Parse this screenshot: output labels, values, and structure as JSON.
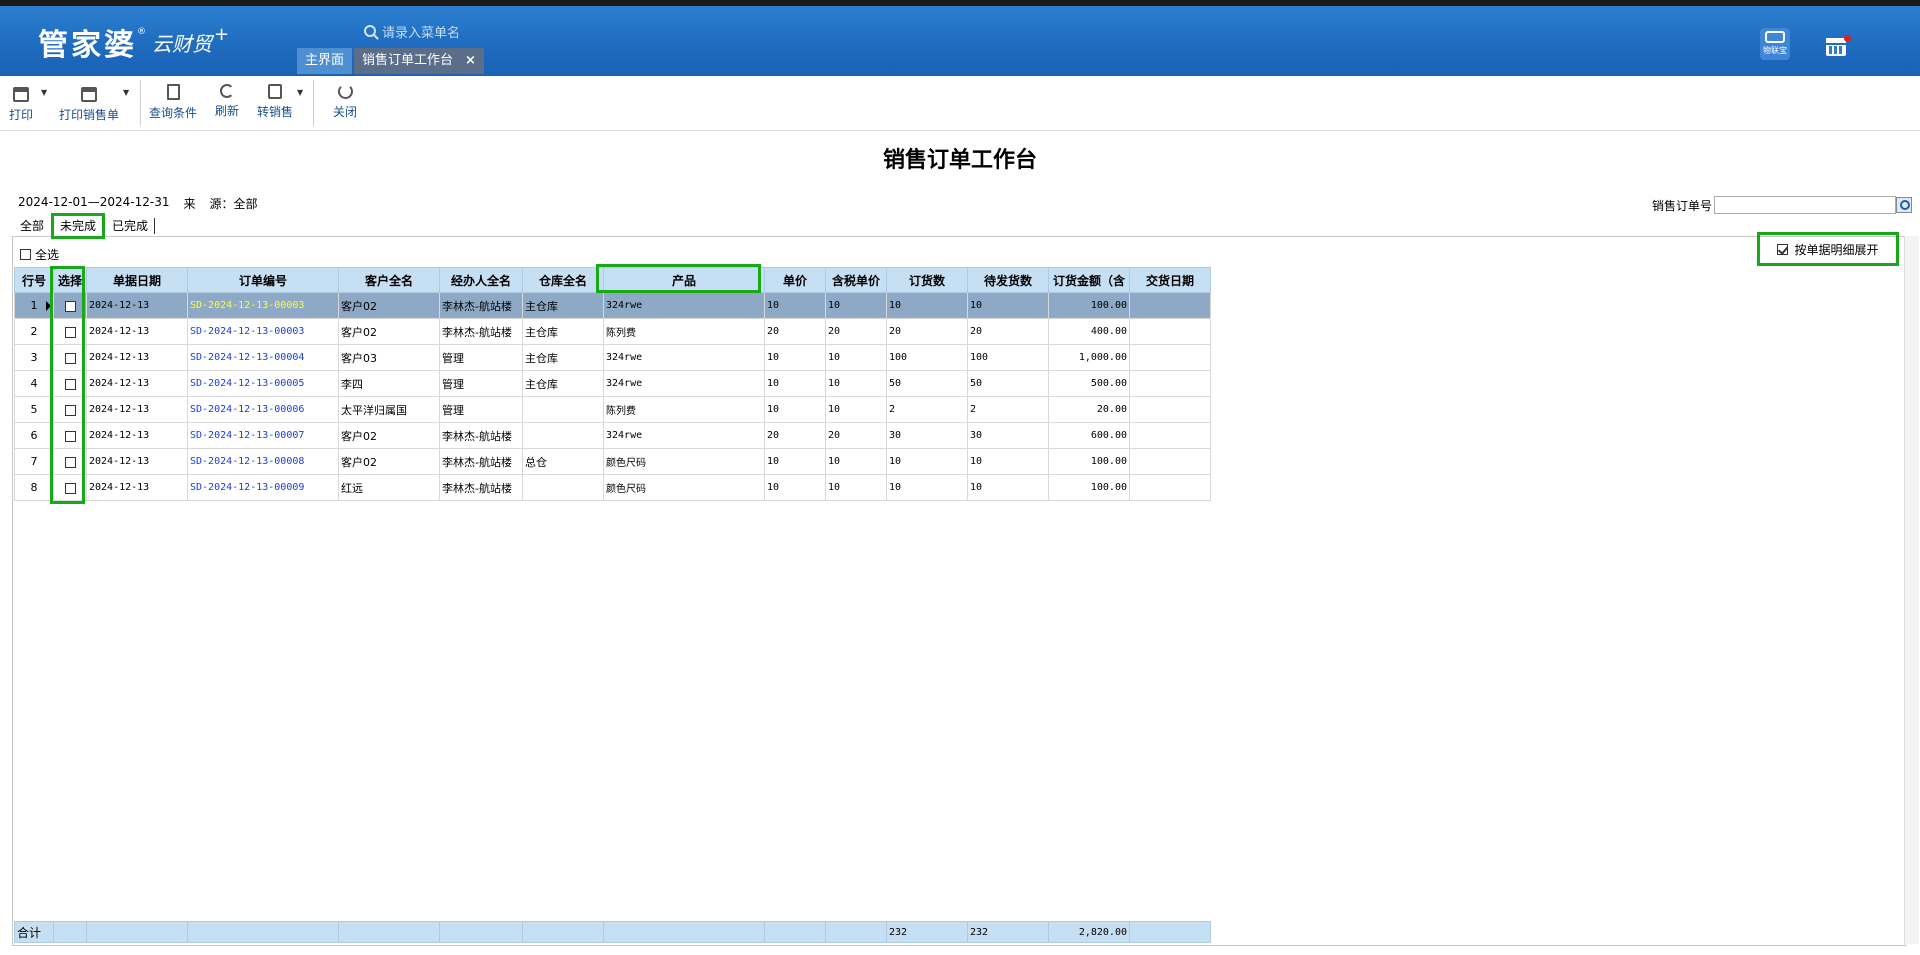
{
  "header": {
    "logo_main": "管家婆",
    "logo_reg": "®",
    "logo_sub": "云财贸",
    "logo_plus": "+",
    "search_placeholder": "请录入菜单名",
    "tabs": [
      {
        "label": "主界面"
      },
      {
        "label": "销售订单工作台",
        "close": "×"
      }
    ],
    "icon_iot_label": "物联宝"
  },
  "toolbar": {
    "print": "打印",
    "print_order": "打印销售单",
    "query": "查询条件",
    "refresh": "刷新",
    "transfer": "转销售",
    "close": "关闭"
  },
  "page": {
    "title": "销售订单工作台",
    "date_range": "2024-12-01—2024-12-31",
    "source_label": "来",
    "source_label2": "源：全部",
    "order_no_label": "销售订单号",
    "status_tabs": [
      "全部",
      "未完成",
      "已完成"
    ],
    "active_status": "未完成",
    "select_all": "全选",
    "expand_label": "按单据明细展开"
  },
  "table": {
    "columns": [
      "行号",
      "选择",
      "单据日期",
      "订单编号",
      "客户全名",
      "经办人全名",
      "仓库全名",
      "产品",
      "单价",
      "含税单价",
      "订货数",
      "待发货数",
      "订货金额（含",
      "交货日期"
    ],
    "rows": [
      {
        "no": "1",
        "date": "2024-12-13",
        "code": "SD-2024-12-13-00003",
        "customer": "客户02",
        "handler": "李林杰-航站楼",
        "warehouse": "主仓库",
        "product": "324rwe",
        "price": "10",
        "taxprice": "10",
        "qty": "10",
        "pending": "10",
        "amount": "100.00",
        "delivery": ""
      },
      {
        "no": "2",
        "date": "2024-12-13",
        "code": "SD-2024-12-13-00003",
        "customer": "客户02",
        "handler": "李林杰-航站楼",
        "warehouse": "主仓库",
        "product": "陈列费",
        "price": "20",
        "taxprice": "20",
        "qty": "20",
        "pending": "20",
        "amount": "400.00",
        "delivery": ""
      },
      {
        "no": "3",
        "date": "2024-12-13",
        "code": "SD-2024-12-13-00004",
        "customer": "客户03",
        "handler": "管理",
        "warehouse": "主仓库",
        "product": "324rwe",
        "price": "10",
        "taxprice": "10",
        "qty": "100",
        "pending": "100",
        "amount": "1,000.00",
        "delivery": ""
      },
      {
        "no": "4",
        "date": "2024-12-13",
        "code": "SD-2024-12-13-00005",
        "customer": "李四",
        "handler": "管理",
        "warehouse": "主仓库",
        "product": "324rwe",
        "price": "10",
        "taxprice": "10",
        "qty": "50",
        "pending": "50",
        "amount": "500.00",
        "delivery": ""
      },
      {
        "no": "5",
        "date": "2024-12-13",
        "code": "SD-2024-12-13-00006",
        "customer": "太平洋归属国",
        "handler": "管理",
        "warehouse": "",
        "product": "陈列费",
        "price": "10",
        "taxprice": "10",
        "qty": "2",
        "pending": "2",
        "amount": "20.00",
        "delivery": ""
      },
      {
        "no": "6",
        "date": "2024-12-13",
        "code": "SD-2024-12-13-00007",
        "customer": "客户02",
        "handler": "李林杰-航站楼",
        "warehouse": "",
        "product": "324rwe",
        "price": "20",
        "taxprice": "20",
        "qty": "30",
        "pending": "30",
        "amount": "600.00",
        "delivery": ""
      },
      {
        "no": "7",
        "date": "2024-12-13",
        "code": "SD-2024-12-13-00008",
        "customer": "客户02",
        "handler": "李林杰-航站楼",
        "warehouse": "总仓",
        "product": "颜色尺码",
        "price": "10",
        "taxprice": "10",
        "qty": "10",
        "pending": "10",
        "amount": "100.00",
        "delivery": ""
      },
      {
        "no": "8",
        "date": "2024-12-13",
        "code": "SD-2024-12-13-00009",
        "customer": "红远",
        "handler": "李林杰-航站楼",
        "warehouse": "",
        "product": "颜色尺码",
        "price": "10",
        "taxprice": "10",
        "qty": "10",
        "pending": "10",
        "amount": "100.00",
        "delivery": ""
      }
    ],
    "totals": {
      "label": "合计",
      "qty": "232",
      "pending": "232",
      "amount": "2,820.00"
    }
  },
  "colors": {
    "header_blue": "#1f6cc0",
    "highlight_green": "#18a818",
    "selected_row": "#8da9c5",
    "column_header": "#c7dff3",
    "code_blue": "#1a3fd6"
  }
}
